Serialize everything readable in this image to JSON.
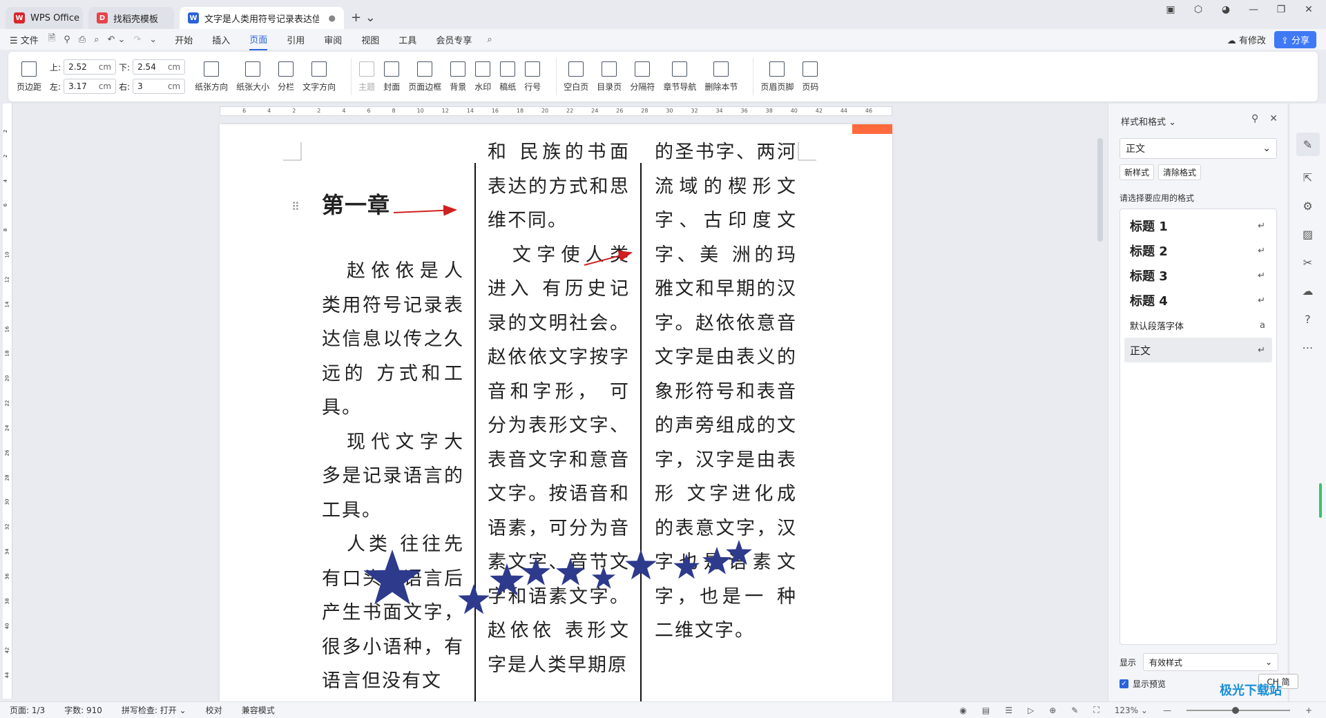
{
  "tabs": [
    {
      "label": "WPS Office",
      "logo": "W",
      "color": "#d9272e"
    },
    {
      "label": "找稻壳模板",
      "logo": "D",
      "color": "#e8434a"
    },
    {
      "label": "文字是人类用符号记录表达信息以",
      "logo": "W",
      "color": "#2b63d9"
    }
  ],
  "menu": {
    "file": "☰ 文件",
    "tabs": [
      "开始",
      "插入",
      "页面",
      "引用",
      "审阅",
      "视图",
      "工具",
      "会员专享"
    ],
    "active_tab": "页面",
    "modified": "有修改",
    "share": "分享"
  },
  "ribbon": {
    "margins_button": "页边距",
    "top_label": "上:",
    "top_value": "2.52",
    "bottom_label": "下:",
    "bottom_value": "2.54",
    "left_label": "左:",
    "left_value": "3.17",
    "right_label": "右:",
    "right_value": "3",
    "unit": "cm",
    "buttons_a": [
      "纸张方向",
      "纸张大小",
      "分栏",
      "文字方向"
    ],
    "buttons_b": [
      "主题",
      "封面",
      "页面边框",
      "背景",
      "水印",
      "稿纸",
      "行号"
    ],
    "buttons_c": [
      "空白页",
      "目录页",
      "分隔符",
      "章节导航",
      "删除本节"
    ],
    "buttons_d": [
      "页眉页脚",
      "页码"
    ]
  },
  "document": {
    "chapter_title": "第一章",
    "column1": [
      {
        "text": "赵依依是人类用符号记录表达信息以传之久远的 方式和工具。",
        "indent": true
      },
      {
        "text": "现代文字大多是记录语言的工具。",
        "indent": true
      },
      {
        "text": "人类 往往先有口头的语言后产生书面文字，很多小语种，有语言但没有文",
        "indent": true
      }
    ],
    "column2": [
      {
        "text": "和 民族的书面表达的方式和思维不同。",
        "indent": false
      },
      {
        "text": "文字使人类进入 有历史记录的文明社会。赵依依文字按字音和字形， 可分为表形文字、表音文字和意音文字。按语音和语素，可分为音素文字、音节文字和语素文字。 赵依依 表形文字是人类早期原",
        "indent": true
      }
    ],
    "column3": [
      {
        "text": "的圣书字、两河流域的楔形文字、古印度文字、美 洲的玛雅文和早期的汉字。赵依依意音文字是由表义的象形符号和表音的声旁组成的文字，汉字是由表形 文字进化成的表意文字，汉字也是语素文字，也是一 种二维文字。",
        "indent": false
      }
    ],
    "ruler_ticks": [
      "6",
      "4",
      "2",
      "2",
      "4",
      "6",
      "8",
      "10",
      "12",
      "14",
      "16",
      "18",
      "20",
      "22",
      "24",
      "26",
      "28",
      "30",
      "32",
      "34",
      "36",
      "38",
      "40",
      "42",
      "44",
      "46"
    ],
    "vruler_ticks": [
      "2",
      "2",
      "4",
      "6",
      "8",
      "10",
      "12",
      "14",
      "16",
      "18",
      "20",
      "22",
      "24",
      "26",
      "28",
      "30",
      "32",
      "34",
      "36",
      "38",
      "40",
      "42",
      "44"
    ]
  },
  "style_panel": {
    "title": "样式和格式",
    "current_style": "正文",
    "new_style": "新样式",
    "clear_format": "清除格式",
    "hint": "请选择要应用的格式",
    "styles": [
      {
        "name": "标题 1",
        "mark": "↵"
      },
      {
        "name": "标题 2",
        "mark": "↵"
      },
      {
        "name": "标题 3",
        "mark": "↵"
      },
      {
        "name": "标题 4",
        "mark": "↵"
      },
      {
        "name": "默认段落字体",
        "mark": "a"
      },
      {
        "name": "正文",
        "mark": "↵"
      }
    ],
    "show_label": "显示",
    "show_value": "有效样式",
    "preview_label": "显示预览"
  },
  "status": {
    "page": "页面: 1/3",
    "words": "字数: 910",
    "spell": "拼写检查: 打开",
    "proof": "校对",
    "compat": "兼容模式",
    "zoom": "123%",
    "ime": "CH 简"
  },
  "watermark_text": "极光下载站",
  "colors": {
    "accent": "#2b63d9",
    "star": "#2e3a8c",
    "arrow": "#d02020",
    "orange_tag": "#ff6a3d"
  }
}
